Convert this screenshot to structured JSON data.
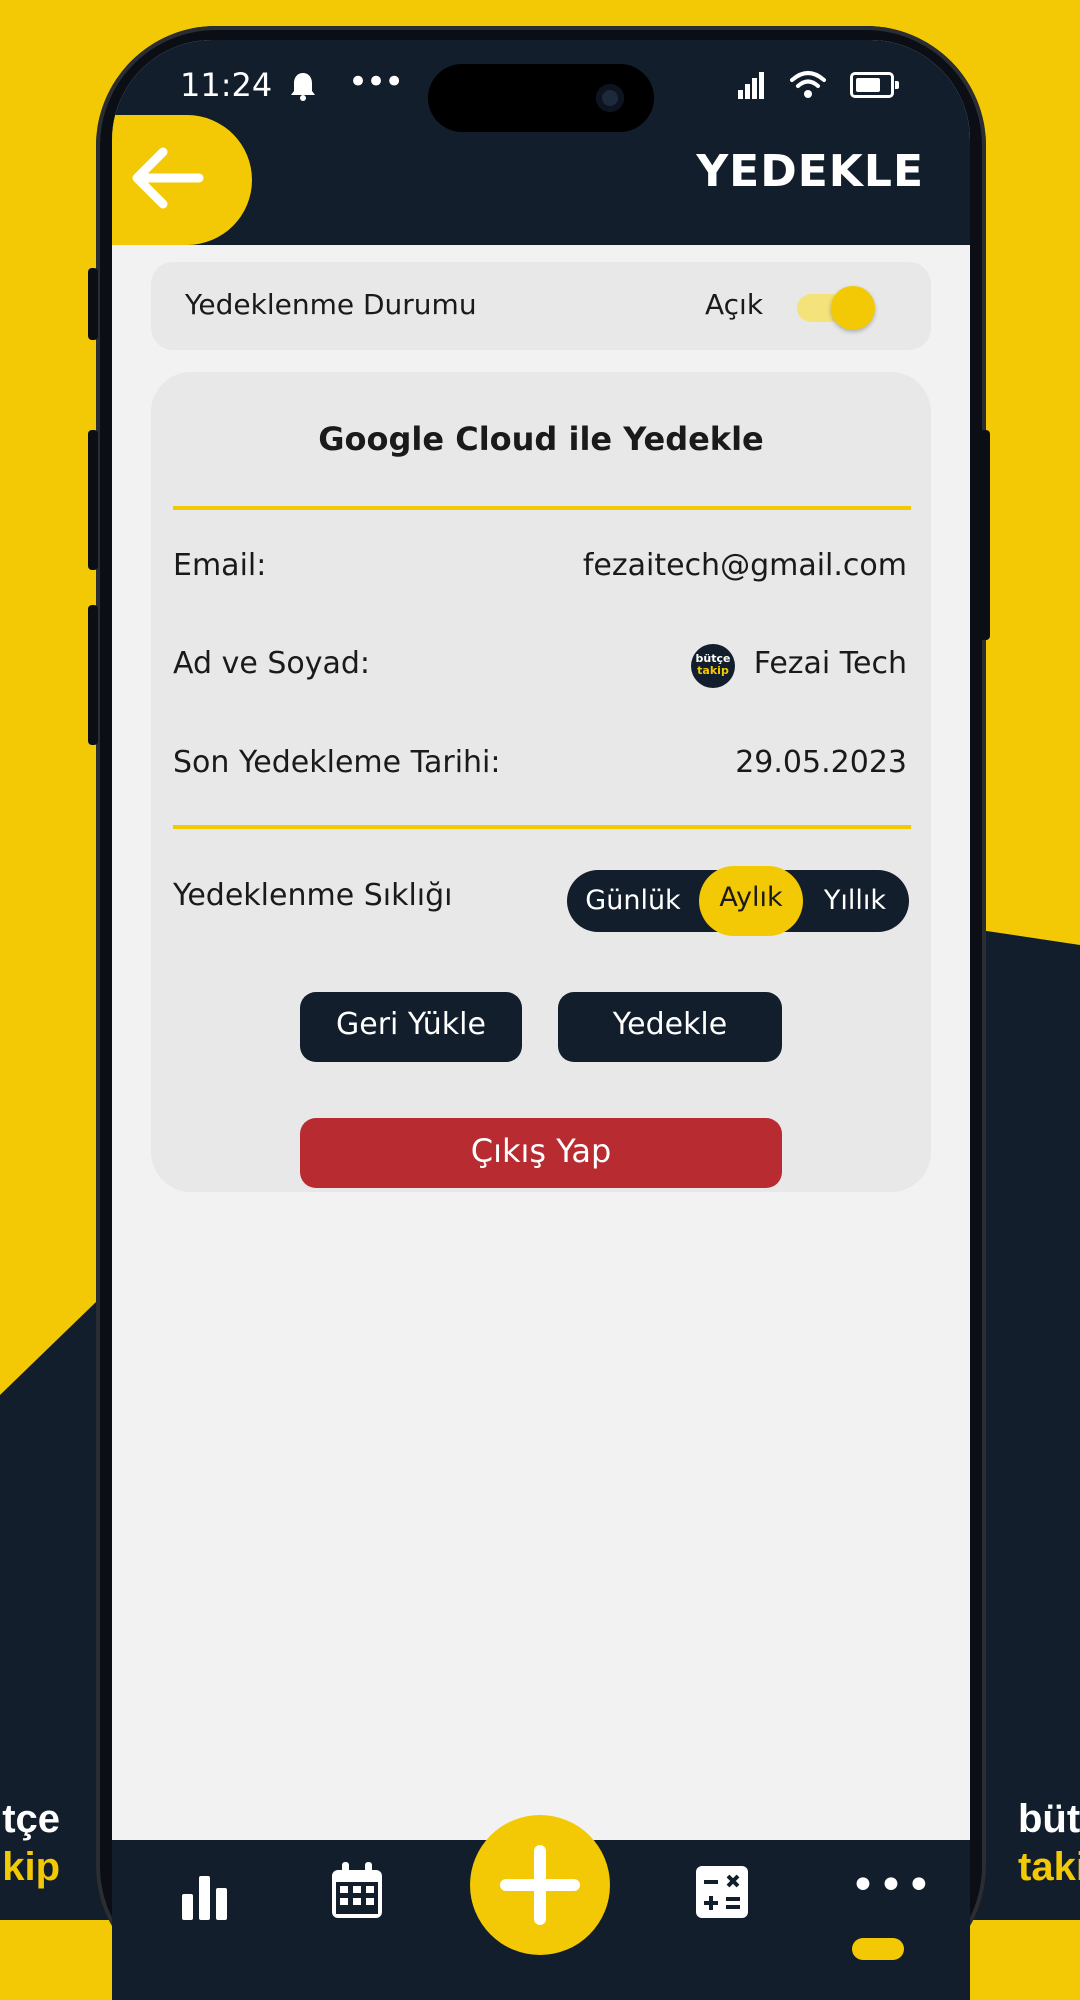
{
  "status_bar": {
    "time": "11:24",
    "bell": "bell-icon",
    "more": "•••"
  },
  "header": {
    "title": "YEDEKLE",
    "back_icon": "arrow-left-icon"
  },
  "backup_status": {
    "label": "Yedeklenme Durumu",
    "value": "Açık",
    "enabled": true
  },
  "card": {
    "title": "Google Cloud ile Yedekle",
    "email_label": "Email:",
    "email_value": "fezaitech@gmail.com",
    "name_label": "Ad ve Soyad:",
    "name_value": "Fezai Tech",
    "avatar_top": "bütçe",
    "avatar_bottom": "takip",
    "last_backup_label": "Son Yedekleme Tarihi:",
    "last_backup_value": "29.05.2023",
    "frequency_label": "Yedeklenme Sıklığı",
    "frequency_options": [
      "Günlük",
      "Aylık",
      "Yıllık"
    ],
    "frequency_selected": "Aylık",
    "restore_button": "Geri Yükle",
    "backup_button": "Yedekle",
    "logout_button": "Çıkış Yap"
  },
  "bottom_nav": {
    "items": [
      "chart-icon",
      "calendar-icon",
      "plus-icon",
      "calculator-icon",
      "more-icon"
    ],
    "more_label": "•••"
  },
  "brand": {
    "line1": "bütçe",
    "line2": "takip",
    "left_line1": "tçe",
    "left_line2": "kip"
  },
  "colors": {
    "accent": "#f2c904",
    "dark": "#121e2b",
    "danger": "#b72b31",
    "background": "#f2f2f2"
  }
}
